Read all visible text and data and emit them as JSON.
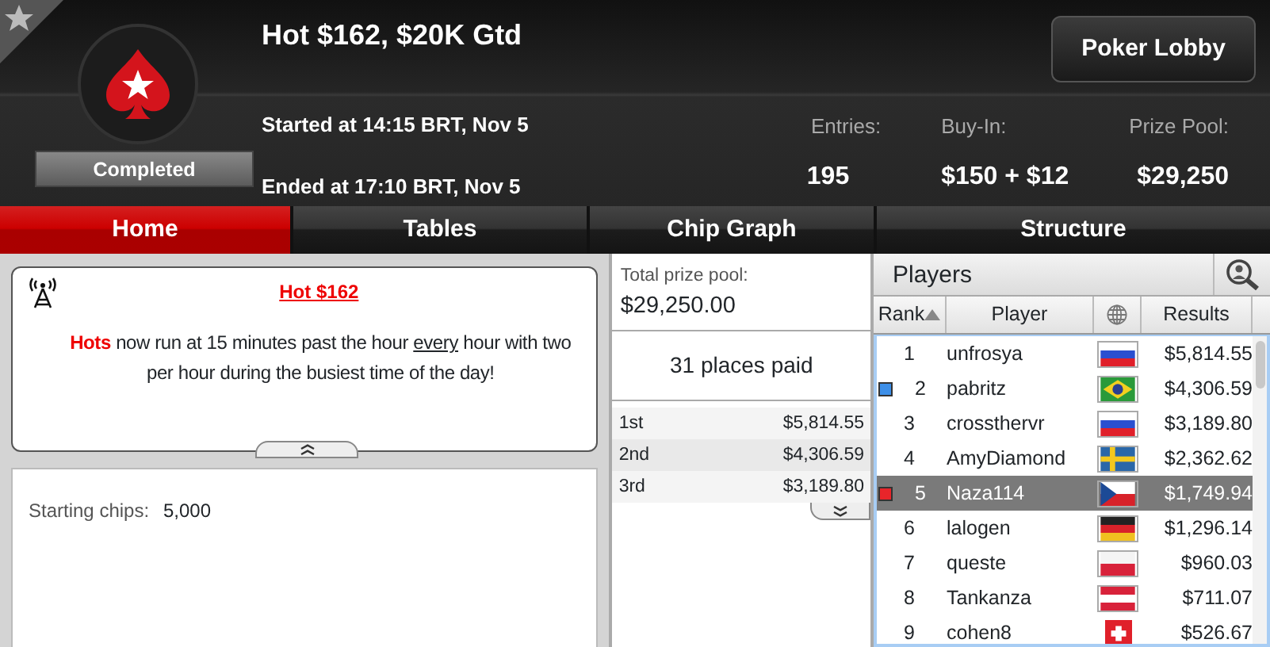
{
  "tournament": {
    "title": "Hot $162, $20K Gtd",
    "status": "Completed",
    "started": "Started at 14:15 BRT, Nov 5",
    "ended": "Ended at 17:10 BRT, Nov 5"
  },
  "lobby_button": "Poker Lobby",
  "stats": [
    {
      "label": "Entries:",
      "value": "195"
    },
    {
      "label": "Buy-In:",
      "value": "$150 + $12"
    },
    {
      "label": "Prize Pool:",
      "value": "$29,250"
    }
  ],
  "tabs": [
    {
      "label": "Home",
      "selected": true
    },
    {
      "label": "Tables",
      "selected": false
    },
    {
      "label": "Chip Graph",
      "selected": false
    },
    {
      "label": "Structure",
      "selected": false
    }
  ],
  "news": {
    "title": "Hot $162",
    "text": "**Hots** now run at 15 minutes past the hour *every* hour with two per hour during the busiest time of the day!"
  },
  "starting_chips": {
    "label": "Starting chips:",
    "value": "5,000"
  },
  "prizes": {
    "total_label": "Total prize pool:",
    "total": "$29,250.00",
    "places": "31 places paid",
    "rows": [
      {
        "place": "1st",
        "amount": "$5,814.55"
      },
      {
        "place": "2nd",
        "amount": "$4,306.59"
      },
      {
        "place": "3rd",
        "amount": "$3,189.80"
      }
    ]
  },
  "players": {
    "title": "Players",
    "columns": [
      {
        "kind": "text",
        "label": "Rank",
        "sorted": true
      },
      {
        "kind": "text",
        "label": "Player",
        "sorted": false
      },
      {
        "kind": "globe",
        "sorted": false
      },
      {
        "kind": "text",
        "label": "Results",
        "sorted": false
      }
    ],
    "rows": [
      {
        "rank": "1",
        "player": "unfrosya",
        "kind": "ru",
        "result": "$5,814.55",
        "selected": false
      },
      {
        "rank": "2",
        "player": "pabritz",
        "kind": "br",
        "result": "$4,306.59",
        "selected": false,
        "color": "#3d8fe8"
      },
      {
        "rank": "3",
        "player": "crossthervr",
        "kind": "ru",
        "result": "$3,189.80",
        "selected": false
      },
      {
        "rank": "4",
        "player": "AmyDiamond",
        "kind": "se",
        "result": "$2,362.62",
        "selected": false
      },
      {
        "rank": "5",
        "player": "Naza114",
        "kind": "cz",
        "result": "$1,749.94",
        "selected": true,
        "color": "#e8252a"
      },
      {
        "rank": "6",
        "player": "lalogen",
        "kind": "de",
        "result": "$1,296.14",
        "selected": false
      },
      {
        "rank": "7",
        "player": "queste",
        "kind": "pl",
        "result": "$960.03",
        "selected": false
      },
      {
        "rank": "8",
        "player": "Tankanza",
        "kind": "at",
        "result": "$711.07",
        "selected": false
      },
      {
        "rank": "9",
        "player": "cohen8",
        "kind": "ch",
        "result": "$526.67",
        "selected": false
      }
    ]
  }
}
